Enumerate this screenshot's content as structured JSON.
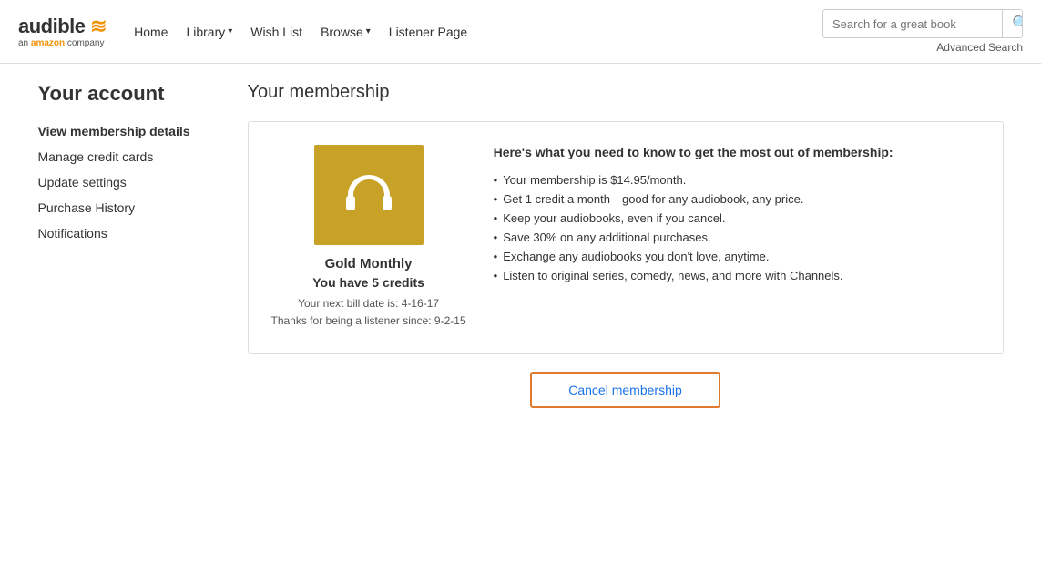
{
  "header": {
    "logo": {
      "brand": "audible",
      "tagline": "an amazon company"
    },
    "nav": {
      "items": [
        {
          "label": "Home",
          "hasDropdown": false
        },
        {
          "label": "Library",
          "hasDropdown": true
        },
        {
          "label": "Wish List",
          "hasDropdown": false
        },
        {
          "label": "Browse",
          "hasDropdown": true
        },
        {
          "label": "Listener Page",
          "hasDropdown": false
        }
      ]
    },
    "search": {
      "placeholder": "Search for a great book",
      "advanced_label": "Advanced Search"
    }
  },
  "sidebar": {
    "title": "Your account",
    "nav_items": [
      {
        "label": "View membership details",
        "active": true
      },
      {
        "label": "Manage credit cards",
        "active": false
      },
      {
        "label": "Update settings",
        "active": false
      },
      {
        "label": "Purchase History",
        "active": false
      },
      {
        "label": "Notifications",
        "active": false
      }
    ]
  },
  "content": {
    "section_title": "Your membership",
    "membership": {
      "icon_label": "audible-logo",
      "plan_name": "Gold Monthly",
      "credits_label": "You have 5 credits",
      "next_bill": "Your next bill date is: 4-16-17",
      "listener_since": "Thanks for being a listener since: 9-2-15",
      "intro_text": "Here's what you need to know to get the most out of membership:",
      "benefits": [
        "Your membership is $14.95/month.",
        "Get 1 credit a month—good for any audiobook, any price.",
        "Keep your audiobooks, even if you cancel.",
        "Save 30% on any additional purchases.",
        "Exchange any audiobooks you don't love, anytime.",
        "Listen to original series, comedy, news, and more with Channels."
      ],
      "cancel_label": "Cancel membership"
    }
  },
  "colors": {
    "gold": "#c8a227",
    "orange_border": "#e07b2d",
    "nav_blue": "#1a73e8",
    "text_dark": "#333333"
  }
}
